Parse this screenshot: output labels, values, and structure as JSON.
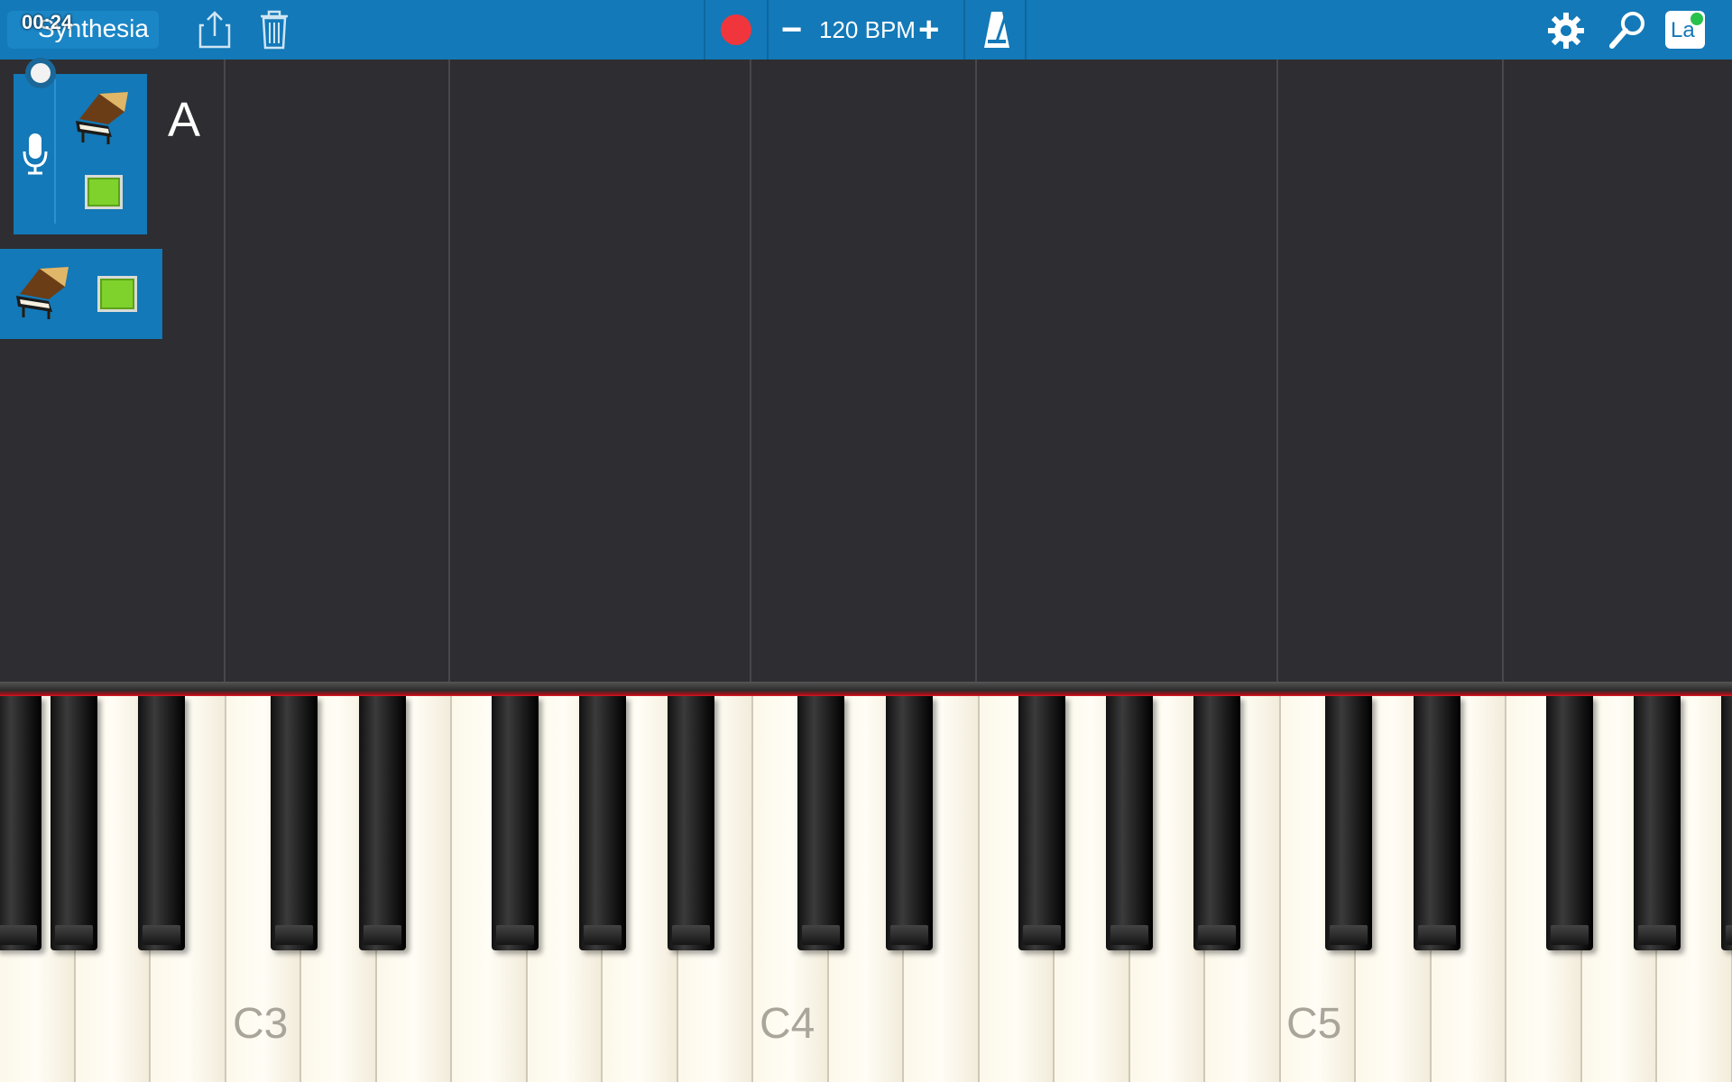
{
  "app": {
    "back_label": "Synthesia",
    "clock": "00:24"
  },
  "toolbar": {
    "bpm_label": "120 BPM",
    "minus_label": "−",
    "plus_label": "+",
    "record_color": "#f0363c",
    "accent_color": "#1379b8",
    "icons": [
      "share-icon",
      "trash-icon",
      "record-icon",
      "metronome-icon",
      "gear-icon",
      "search-icon",
      "keyboard-layout-icon"
    ],
    "layout_badge": "La"
  },
  "tracks": [
    {
      "letter": "A",
      "instrument": "grand-piano-icon",
      "swatch_color": "#7ed22b",
      "mic": "microphone-icon"
    },
    {
      "instrument": "grand-piano-icon",
      "swatch_color": "#7ed22b"
    }
  ],
  "keyboard": {
    "octave_labels": [
      "C3",
      "C4",
      "C5"
    ],
    "hit_line_color": "#e21d24"
  }
}
